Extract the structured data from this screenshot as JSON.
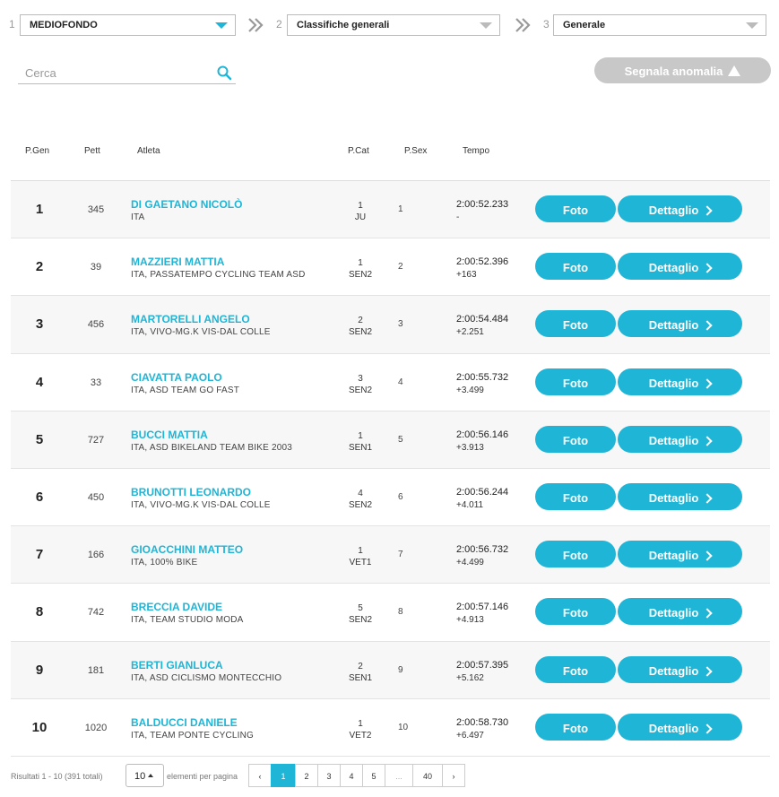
{
  "filters": {
    "step1": {
      "num": "1",
      "value": "MEDIOFONDO"
    },
    "step2": {
      "num": "2",
      "value": "Classifiche generali"
    },
    "step3": {
      "num": "3",
      "value": "Generale"
    }
  },
  "search": {
    "placeholder": "Cerca"
  },
  "report_button": {
    "label": "Segnala anomalia"
  },
  "table": {
    "headers": {
      "pgen": "P.Gen",
      "pett": "Pett",
      "atleta": "Atleta",
      "pcat": "P.Cat",
      "psex": "P.Sex",
      "tempo": "Tempo"
    },
    "foto_label": "Foto",
    "detail_label": "Dettaglio",
    "rows": [
      {
        "pos": "1",
        "pett": "345",
        "name": "DI GAETANO NICOLÒ",
        "team": "ITA",
        "pcat": "1",
        "cat": "JU",
        "psex": "1",
        "time": "2:00:52.233",
        "gap": "-"
      },
      {
        "pos": "2",
        "pett": "39",
        "name": "MAZZIERI MATTIA",
        "team": "ITA, PASSATEMPO CYCLING TEAM ASD",
        "pcat": "1",
        "cat": "SEN2",
        "psex": "2",
        "time": "2:00:52.396",
        "gap": "+163"
      },
      {
        "pos": "3",
        "pett": "456",
        "name": "MARTORELLI ANGELO",
        "team": "ITA, VIVO-MG.K VIS-DAL COLLE",
        "pcat": "2",
        "cat": "SEN2",
        "psex": "3",
        "time": "2:00:54.484",
        "gap": "+2.251"
      },
      {
        "pos": "4",
        "pett": "33",
        "name": "CIAVATTA PAOLO",
        "team": "ITA, ASD TEAM GO FAST",
        "pcat": "3",
        "cat": "SEN2",
        "psex": "4",
        "time": "2:00:55.732",
        "gap": "+3.499"
      },
      {
        "pos": "5",
        "pett": "727",
        "name": "BUCCI MATTIA",
        "team": "ITA, ASD BIKELAND TEAM BIKE 2003",
        "pcat": "1",
        "cat": "SEN1",
        "psex": "5",
        "time": "2:00:56.146",
        "gap": "+3.913"
      },
      {
        "pos": "6",
        "pett": "450",
        "name": "BRUNOTTI LEONARDO",
        "team": "ITA, VIVO-MG.K VIS-DAL COLLE",
        "pcat": "4",
        "cat": "SEN2",
        "psex": "6",
        "time": "2:00:56.244",
        "gap": "+4.011"
      },
      {
        "pos": "7",
        "pett": "166",
        "name": "GIOACCHINI MATTEO",
        "team": "ITA, 100% BIKE",
        "pcat": "1",
        "cat": "VET1",
        "psex": "7",
        "time": "2:00:56.732",
        "gap": "+4.499"
      },
      {
        "pos": "8",
        "pett": "742",
        "name": "BRECCIA DAVIDE",
        "team": "ITA, TEAM STUDIO MODA",
        "pcat": "5",
        "cat": "SEN2",
        "psex": "8",
        "time": "2:00:57.146",
        "gap": "+4.913"
      },
      {
        "pos": "9",
        "pett": "181",
        "name": "BERTI GIANLUCA",
        "team": "ITA, ASD CICLISMO MONTECCHIO",
        "pcat": "2",
        "cat": "SEN1",
        "psex": "9",
        "time": "2:00:57.395",
        "gap": "+5.162"
      },
      {
        "pos": "10",
        "pett": "1020",
        "name": "BALDUCCI DANIELE",
        "team": "ITA, TEAM PONTE CYCLING",
        "pcat": "1",
        "cat": "VET2",
        "psex": "10",
        "time": "2:00:58.730",
        "gap": "+6.497"
      }
    ]
  },
  "pagination": {
    "results": "Risultati 1 - 10 (391 totali)",
    "per_page": "10",
    "per_page_label": "elementi per pagina",
    "prev": "‹",
    "pages": [
      "1",
      "2",
      "3",
      "4",
      "5",
      "...",
      "40"
    ],
    "next": "›",
    "active_page": "1"
  },
  "colors": {
    "accent": "#1fb5d6",
    "disabled": "#c8c8c8"
  }
}
